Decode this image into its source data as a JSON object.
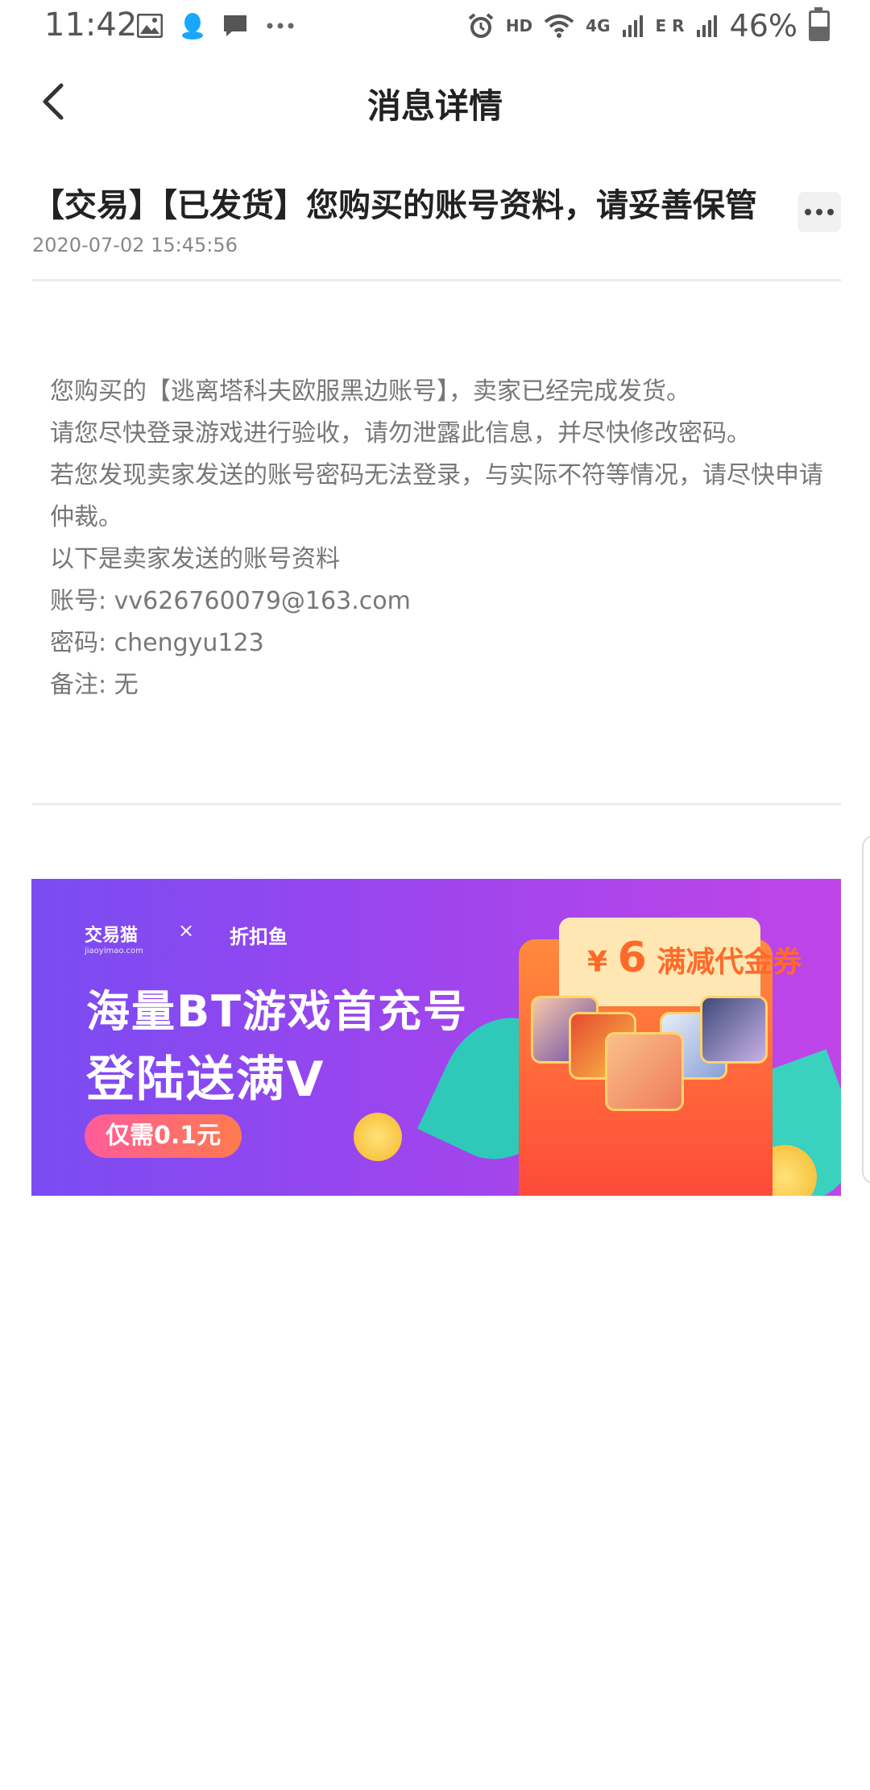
{
  "status_bar": {
    "time": "11:42",
    "left_icons": [
      "gallery-icon",
      "qq-icon",
      "message-icon",
      "more-dots-icon"
    ],
    "right_icons": [
      "alarm-icon",
      "hd-icon",
      "wifi-icon",
      "4g-signal-icon",
      "signal-icon"
    ],
    "hd_label": "HD",
    "network_label": "4G",
    "signal2_label": "E R",
    "battery_percent": "46%",
    "battery_level": 0.46
  },
  "header": {
    "back_icon": "chevron-left-icon",
    "title": "消息详情"
  },
  "message": {
    "title": "【交易】【已发货】您购买的账号资料，请妥善保管",
    "time": "2020-07-02 15:45:56",
    "more_icon": "more-dots-icon",
    "body_lines": [
      "您购买的【逃离塔科夫欧服黑边账号】，卖家已经完成发货。",
      "请您尽快登录游戏进行验收，请勿泄露此信息，并尽快修改密码。",
      "若您发现卖家发送的账号密码无法登录，与实际不符等情况，请尽快申请",
      "仲裁。",
      "以下是卖家发送的账号资料",
      "账号: vv626760079@163.com",
      "密码: chengyu123",
      "备注: 无"
    ]
  },
  "banner": {
    "logo1": "交易猫",
    "logo1_sub": "jiaoyimao.com",
    "cross": "×",
    "logo2": "折扣鱼",
    "headline1": "海量BT游戏首充号",
    "headline2": "登陆送满V",
    "pill": "仅需0.1元",
    "coupon_currency": "¥",
    "coupon_amount": "6",
    "coupon_label": "满减代金券",
    "colors": {
      "bg_start": "#7a4cf2",
      "bg_end": "#c045e8",
      "envelope": "#ff5a3a",
      "coupon_text": "#ff6a2a"
    }
  }
}
